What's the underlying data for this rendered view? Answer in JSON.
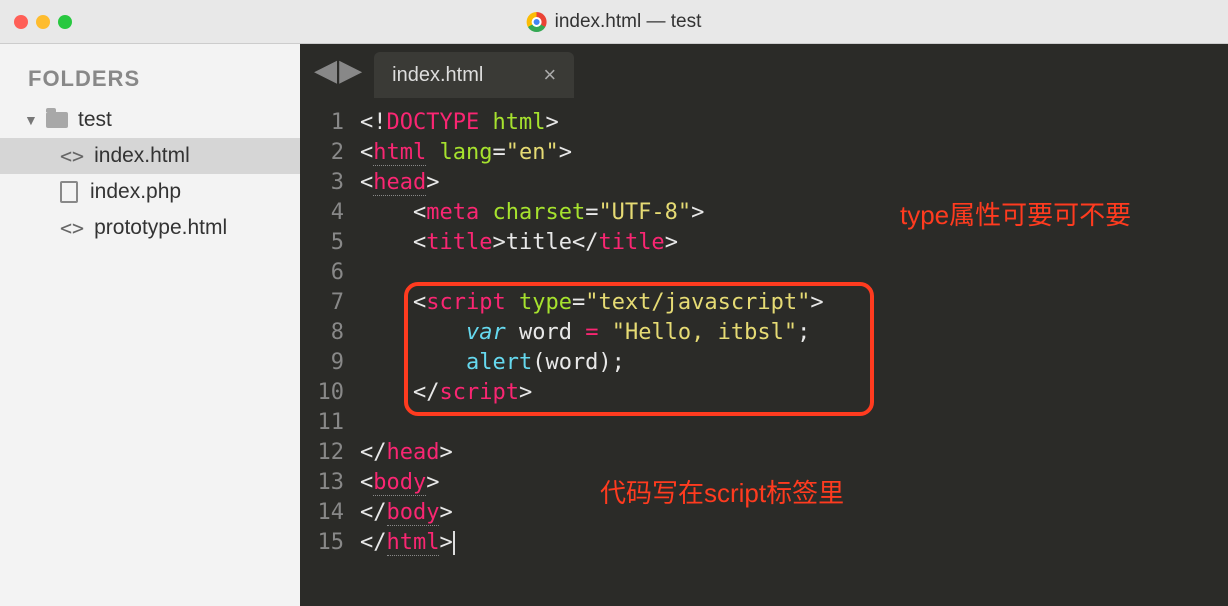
{
  "titlebar": {
    "title": "index.html — test"
  },
  "sidebar": {
    "heading": "FOLDERS",
    "root": "test",
    "files": [
      {
        "name": "index.html",
        "icon": "code",
        "selected": true
      },
      {
        "name": "index.php",
        "icon": "file",
        "selected": false
      },
      {
        "name": "prototype.html",
        "icon": "code",
        "selected": false
      }
    ]
  },
  "tabs": [
    {
      "label": "index.html",
      "active": true
    }
  ],
  "gutter": [
    "1",
    "2",
    "3",
    "4",
    "5",
    "6",
    "7",
    "8",
    "9",
    "10",
    "11",
    "12",
    "13",
    "14",
    "15"
  ],
  "code": {
    "l1": {
      "p1": "<!",
      "p2": "DOCTYPE",
      "p3": " ",
      "p4": "html",
      "p5": ">"
    },
    "l2": {
      "p1": "<",
      "p2": "html",
      "p3": " ",
      "p4": "lang",
      "p5": "=",
      "p6": "\"en\"",
      "p7": ">"
    },
    "l3": {
      "p1": "<",
      "p2": "head",
      "p3": ">"
    },
    "l4": {
      "ind": "    ",
      "p1": "<",
      "p2": "meta",
      "p3": " ",
      "p4": "charset",
      "p5": "=",
      "p6": "\"UTF-8\"",
      "p7": ">"
    },
    "l5": {
      "ind": "    ",
      "p1": "<",
      "p2": "title",
      "p3": ">",
      "p4": "title",
      "p5": "</",
      "p6": "title",
      "p7": ">"
    },
    "l6": {
      "ind": ""
    },
    "l7": {
      "ind": "    ",
      "p1": "<",
      "p2": "script",
      "p3": " ",
      "p4": "type",
      "p5": "=",
      "p6": "\"text/javascript\"",
      "p7": ">"
    },
    "l8": {
      "ind": "        ",
      "p1": "var",
      "p2": " ",
      "p3": "word",
      "p4": " = ",
      "p5": "\"Hello, itbsl\"",
      "p6": ";"
    },
    "l9": {
      "ind": "        ",
      "p1": "alert",
      "p2": "(word);"
    },
    "l10": {
      "ind": "    ",
      "p1": "</",
      "p2": "script",
      "p3": ">"
    },
    "l11": {
      "ind": ""
    },
    "l12": {
      "p1": "</",
      "p2": "head",
      "p3": ">"
    },
    "l13": {
      "p1": "<",
      "p2": "body",
      "p3": ">"
    },
    "l14": {
      "p1": "</",
      "p2": "body",
      "p3": ">"
    },
    "l15": {
      "p1": "</",
      "p2": "html",
      "p3": ">"
    }
  },
  "annotations": {
    "a1": "type属性可要可不要",
    "a2": "代码写在script标签里"
  }
}
